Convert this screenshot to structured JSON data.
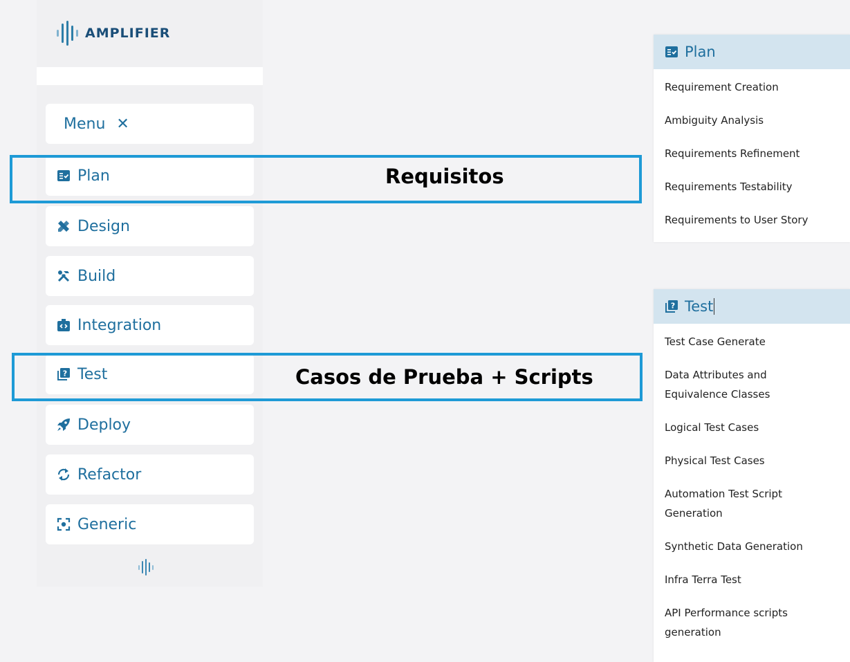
{
  "app": {
    "brand": "AMPLIFIER"
  },
  "sidebar": {
    "menu_label": "Menu",
    "close_glyph": "✕",
    "items": [
      {
        "label": "Plan",
        "icon": "checklist-icon"
      },
      {
        "label": "Design",
        "icon": "design-tools-icon"
      },
      {
        "label": "Build",
        "icon": "wrench-hammer-icon"
      },
      {
        "label": "Integration",
        "icon": "integration-icon"
      },
      {
        "label": "Test",
        "icon": "test-question-icon"
      },
      {
        "label": "Deploy",
        "icon": "rocket-icon"
      },
      {
        "label": "Refactor",
        "icon": "refresh-icon"
      },
      {
        "label": "Generic",
        "icon": "focus-icon"
      }
    ]
  },
  "annotations": {
    "plan_label": "Requisitos",
    "test_label": "Casos de Prueba + Scripts"
  },
  "plan_panel": {
    "title": "Plan",
    "items": [
      "Requirement Creation",
      "Ambiguity Analysis",
      "Requirements Refinement",
      "Requirements Testability",
      "Requirements to User Story"
    ]
  },
  "test_panel": {
    "title": "Test",
    "items": [
      "Test Case Generate",
      "Data Attributes and Equivalence Classes",
      "Logical Test Cases",
      "Physical Test Cases",
      "Automation Test Script Generation",
      "Synthetic Data Generation",
      "Infra Terra Test",
      "API Performance scripts generation"
    ]
  },
  "colors": {
    "accent": "#1f6f9e",
    "highlight": "#1e9ad6",
    "panel_header": "#d3e4ef",
    "background": "#f3f3f5"
  }
}
